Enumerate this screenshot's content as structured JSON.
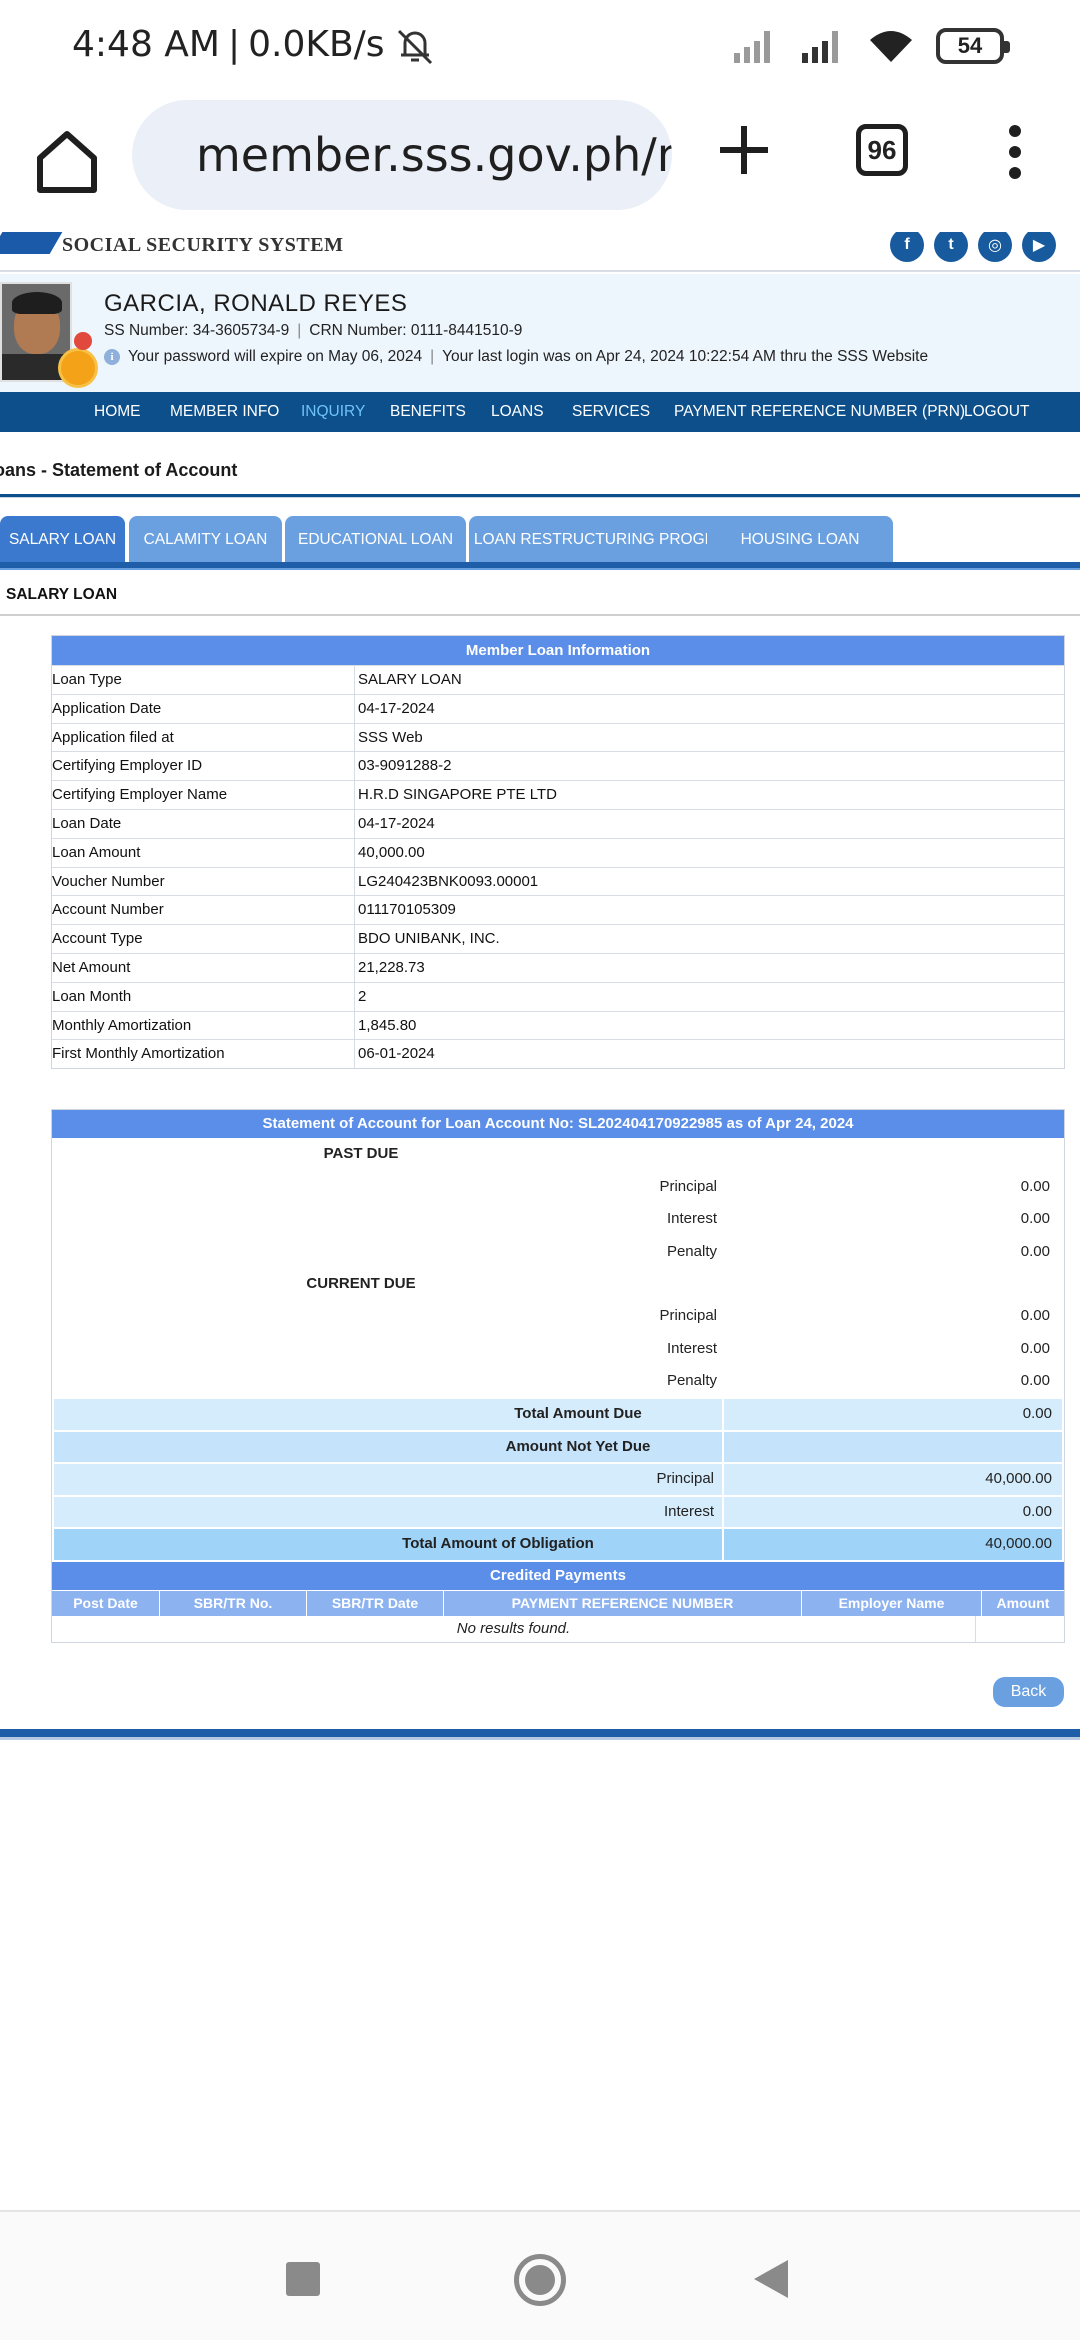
{
  "status_bar": {
    "time": "4:48 AM",
    "network": "0.0KB/s",
    "battery": "54"
  },
  "browser": {
    "url": "member.sss.gov.ph/m",
    "tab_count": "96"
  },
  "site": {
    "org_name": "SOCIAL SECURITY SYSTEM",
    "social_icons": [
      "facebook-icon",
      "twitter-icon",
      "instagram-icon",
      "youtube-icon"
    ]
  },
  "member": {
    "name": "GARCIA,  RONALD  REYES",
    "ss_number": "SS Number: 34-3605734-9",
    "crn_number": "CRN Number: 0111-8441510-9",
    "password_notice": "Your password will expire on May 06, 2024",
    "last_login": "Your last login was on Apr 24, 2024 10:22:54 AM thru the SSS Website"
  },
  "nav": {
    "items": [
      "HOME",
      "MEMBER INFO",
      "INQUIRY",
      "BENEFITS",
      "LOANS",
      "SERVICES",
      "PAYMENT REFERENCE NUMBER (PRN)",
      "LOGOUT"
    ],
    "active": "INQUIRY"
  },
  "page": {
    "title": "oans - Statement of Account",
    "section_title": "SALARY LOAN"
  },
  "tabs": [
    "SALARY LOAN",
    "CALAMITY LOAN",
    "EDUCATIONAL LOAN",
    "LOAN RESTRUCTURING PROGRAM",
    "HOUSING LOAN"
  ],
  "loan_info": {
    "header": "Member Loan Information",
    "rows": [
      {
        "label": "Loan Type",
        "value": "SALARY LOAN"
      },
      {
        "label": "Application Date",
        "value": "04-17-2024"
      },
      {
        "label": "Application filed at",
        "value": "SSS Web"
      },
      {
        "label": "Certifying Employer ID",
        "value": "03-9091288-2"
      },
      {
        "label": "Certifying Employer Name",
        "value": "H.R.D SINGAPORE PTE LTD"
      },
      {
        "label": "Loan Date",
        "value": "04-17-2024"
      },
      {
        "label": "Loan Amount",
        "value": "40,000.00"
      },
      {
        "label": "Voucher Number",
        "value": "LG240423BNK0093.00001"
      },
      {
        "label": "Account Number",
        "value": "011170105309"
      },
      {
        "label": "Account Type",
        "value": "BDO UNIBANK, INC."
      },
      {
        "label": "Net Amount",
        "value": "21,228.73"
      },
      {
        "label": "Loan Month",
        "value": "2"
      },
      {
        "label": "Monthly Amortization",
        "value": "1,845.80"
      },
      {
        "label": "First Monthly Amortization",
        "value": "06-01-2024"
      }
    ]
  },
  "statement": {
    "header": "Statement of Account for Loan Account No: SL202404170922985 as of Apr 24, 2024",
    "past_due_label": "PAST DUE",
    "past_due": [
      {
        "label": "Principal",
        "value": "0.00"
      },
      {
        "label": "Interest",
        "value": "0.00"
      },
      {
        "label": "Penalty",
        "value": "0.00"
      }
    ],
    "current_due_label": "CURRENT DUE",
    "current_due": [
      {
        "label": "Principal",
        "value": "0.00"
      },
      {
        "label": "Interest",
        "value": "0.00"
      },
      {
        "label": "Penalty",
        "value": "0.00"
      }
    ],
    "total_amount_due_label": "Total Amount Due",
    "total_amount_due": "0.00",
    "not_yet_due_label": "Amount Not Yet Due",
    "not_yet_due_principal_label": "Principal",
    "not_yet_due_principal": "40,000.00",
    "not_yet_due_interest_label": "Interest",
    "not_yet_due_interest": "0.00",
    "total_obligation_label": "Total Amount of Obligation",
    "total_obligation": "40,000.00"
  },
  "credited_payments": {
    "header": "Credited Payments",
    "columns": [
      "Post Date",
      "SBR/TR No.",
      "SBR/TR Date",
      "PAYMENT REFERENCE NUMBER",
      "Employer Name",
      "Amount"
    ],
    "empty_message": "No results found."
  },
  "actions": {
    "back": "Back"
  }
}
